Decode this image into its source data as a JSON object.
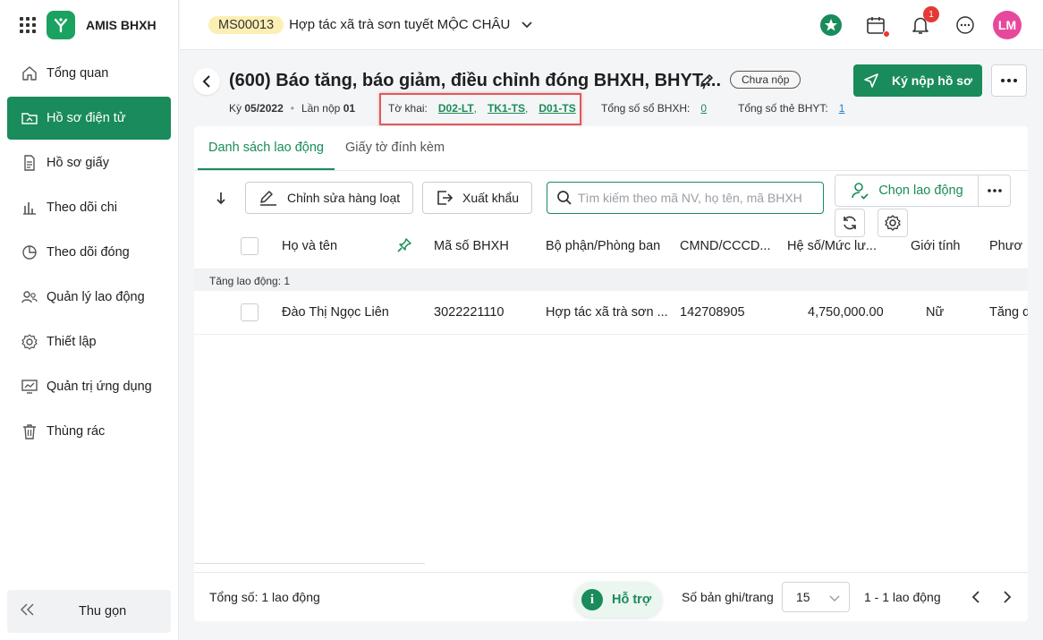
{
  "app": {
    "name": "AMIS BHXH"
  },
  "sidebar": {
    "items": [
      {
        "label": "Tổng quan"
      },
      {
        "label": "Hồ sơ điện tử"
      },
      {
        "label": "Hồ sơ giấy"
      },
      {
        "label": "Theo dõi chi"
      },
      {
        "label": "Theo dõi đóng"
      },
      {
        "label": "Quản lý lao động"
      },
      {
        "label": "Thiết lập"
      },
      {
        "label": "Quản trị ứng dụng"
      },
      {
        "label": "Thùng rác"
      }
    ],
    "collapse_label": "Thu gọn"
  },
  "header": {
    "org_code": "MS00013",
    "org_name": "Hợp tác xã trà sơn tuyết MỘC CHÂU",
    "notification_count": "1",
    "avatar_initials": "LM"
  },
  "page": {
    "title": "(600) Báo tăng, báo giảm, điều chỉnh đóng BHXH, BHYT,...",
    "status": "Chưa nộp",
    "sign_label": "Ký nộp hồ sơ",
    "period_label": "Kỳ",
    "period_value": "05/2022",
    "submit_label": "Lần nộp",
    "submit_value": "01",
    "tokhai_label": "Tờ khai:",
    "tokhai": [
      "D02-LT",
      "TK1-TS",
      "D01-TS"
    ],
    "bhxh_count_label": "Tổng số sổ BHXH:",
    "bhxh_count": "0",
    "bhyt_count_label": "Tổng số thẻ BHYT:",
    "bhyt_count": "1"
  },
  "tabs": [
    {
      "label": "Danh sách lao động"
    },
    {
      "label": "Giấy tờ đính kèm"
    }
  ],
  "toolbar": {
    "bulk_edit": "Chỉnh sửa hàng loạt",
    "export": "Xuất khẩu",
    "search_placeholder": "Tìm kiếm theo mã NV, họ tên, mã BHXH",
    "choose_employee": "Chọn lao động"
  },
  "table": {
    "columns": [
      "Họ và tên",
      "Mã số BHXH",
      "Bộ phận/Phòng ban",
      "CMND/CCCD...",
      "Hệ số/Mức lư...",
      "Giới tính",
      "Phươ"
    ],
    "group_label": "Tăng lao động: 1",
    "rows": [
      {
        "name": "Đào Thị Ngọc Liên",
        "bhxh": "3022221110",
        "dept": "Hợp tác xã trà sơn ...",
        "id": "142708905",
        "salary": "4,750,000.00",
        "gender": "Nữ",
        "method": "Tăng d"
      }
    ]
  },
  "footer": {
    "total_label": "Tổng số:",
    "total_value": "1 lao động",
    "help_label": "Hỗ trợ",
    "per_page_label": "Số bản ghi/trang",
    "per_page_value": "15",
    "range": "1 - 1 lao động"
  },
  "colors": {
    "primary": "#1a8b5a",
    "avatar": "#e8489c",
    "highlight_box": "#e05a5a"
  }
}
